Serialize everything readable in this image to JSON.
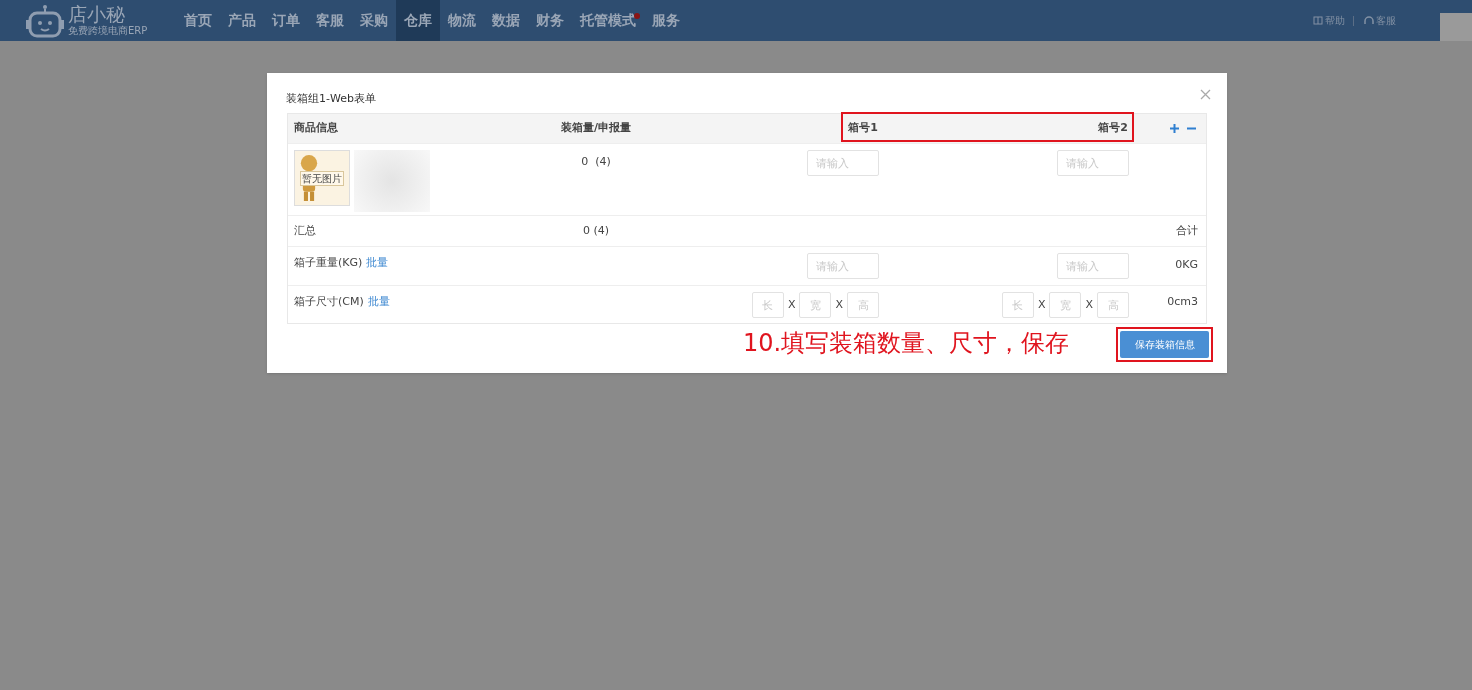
{
  "header": {
    "logo": {
      "name": "店小秘",
      "tagline": "免费跨境电商ERP"
    },
    "nav": [
      {
        "label": "首页",
        "selected": false,
        "badge": false
      },
      {
        "label": "产品",
        "selected": false,
        "badge": false
      },
      {
        "label": "订单",
        "selected": false,
        "badge": false
      },
      {
        "label": "客服",
        "selected": false,
        "badge": false
      },
      {
        "label": "采购",
        "selected": false,
        "badge": false
      },
      {
        "label": "仓库",
        "selected": true,
        "badge": false
      },
      {
        "label": "物流",
        "selected": false,
        "badge": false
      },
      {
        "label": "数据",
        "selected": false,
        "badge": false
      },
      {
        "label": "财务",
        "selected": false,
        "badge": false
      },
      {
        "label": "托管模式",
        "selected": false,
        "badge": true
      },
      {
        "label": "服务",
        "selected": false,
        "badge": false
      }
    ],
    "links": [
      {
        "kind": "help",
        "label": "帮助"
      },
      {
        "kind": "support",
        "label": "客服"
      }
    ]
  },
  "dialog": {
    "title": "装箱组1-Web表单",
    "columns": {
      "product": "商品信息",
      "quantity": "装箱量/申报量",
      "boxes": [
        "箱号1",
        "箱号2"
      ]
    },
    "product_row": {
      "image_caption": "暂无图片",
      "quantity": "0  (4)",
      "box_placeholders": [
        "请输入",
        "请输入"
      ]
    },
    "summary_row": {
      "label": "汇总",
      "quantity": "0 (4)",
      "total_label": "合计"
    },
    "weight_row": {
      "label": "箱子重量(KG)",
      "batch_link": "批量",
      "placeholders": [
        "请输入",
        "请输入"
      ],
      "total": "0KG"
    },
    "size_row": {
      "label": "箱子尺寸(CM)",
      "batch_link": "批量",
      "boxes": [
        {
          "placeholders": [
            "长",
            "宽",
            "高"
          ],
          "separators": [
            "X",
            "X"
          ]
        },
        {
          "placeholders": [
            "长",
            "宽",
            "高"
          ],
          "separators": [
            "X",
            "X"
          ]
        }
      ],
      "total": "0cm3"
    },
    "save_button": "保存装箱信息"
  },
  "annotation": {
    "text": "10.填写装箱数量、尺寸，保存"
  }
}
